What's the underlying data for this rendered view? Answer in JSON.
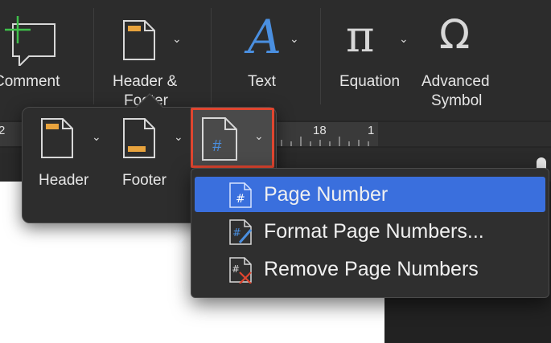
{
  "ribbon": {
    "comment_label": "Comment",
    "header_footer_label_1": "Header &",
    "header_footer_label_2": "Footer",
    "text_label": "Text",
    "equation_label": "Equation",
    "advanced_symbol_label_1": "Advanced",
    "advanced_symbol_label_2": "Symbol",
    "pi_glyph": "π",
    "omega_glyph": "Ω",
    "text_glyph": "A"
  },
  "ruler": {
    "left_number": "2",
    "number_18": "18",
    "number_partial": "1"
  },
  "popover": {
    "header_label": "Header",
    "footer_label": "Footer",
    "page_number_glyph": "#"
  },
  "menu": {
    "items": [
      {
        "label": "Page Number",
        "icon": "page-number-icon",
        "selected": true
      },
      {
        "label": "Format Page Numbers...",
        "icon": "format-page-numbers-icon",
        "selected": false
      },
      {
        "label": "Remove Page Numbers",
        "icon": "remove-page-numbers-icon",
        "selected": false
      }
    ]
  },
  "colors": {
    "accent_blue": "#3a6fdd",
    "highlight_red": "#e0452f",
    "icon_orange": "#e8a33d",
    "comment_green": "#3fbf4a",
    "text_blue": "#4a8fe0"
  }
}
